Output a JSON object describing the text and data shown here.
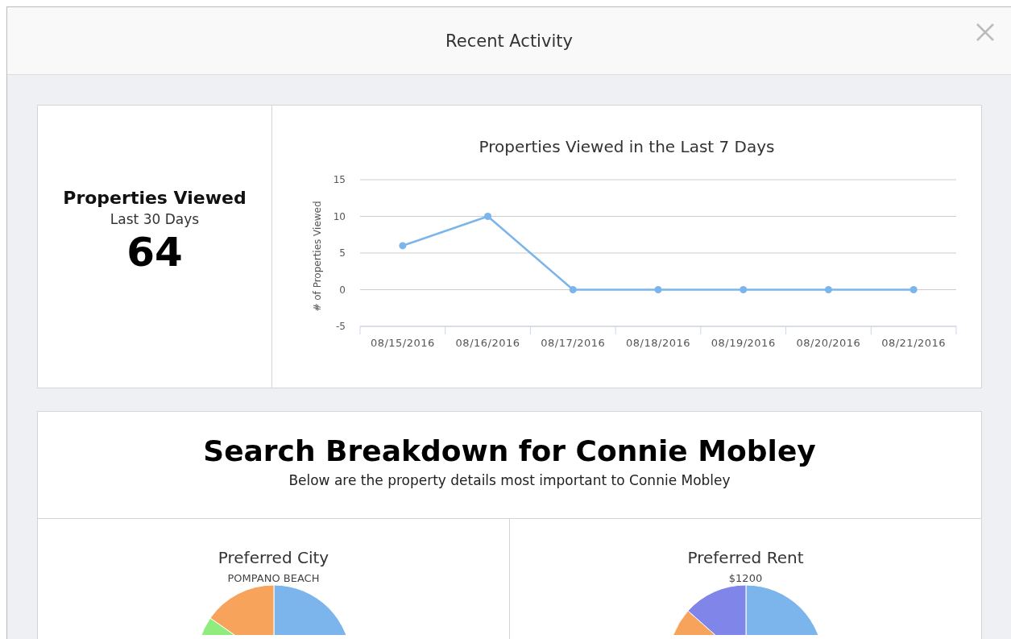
{
  "window": {
    "title": "Recent Activity"
  },
  "summary": {
    "title": "Properties Viewed",
    "subtitle": "Last 30 Days",
    "count": "64"
  },
  "activity_chart": {
    "chart_data": {
      "type": "line",
      "title": "Properties Viewed in the Last 7 Days",
      "ylabel": "# of Properties Viewed",
      "categories": [
        "08/15/2016",
        "08/16/2016",
        "08/17/2016",
        "08/18/2016",
        "08/19/2016",
        "08/20/2016",
        "08/21/2016"
      ],
      "series": [
        {
          "color": "#7cb5ec",
          "marker": true,
          "values": [
            6,
            10,
            0,
            0,
            0,
            0,
            0
          ]
        }
      ],
      "ylim": [
        -5,
        15
      ],
      "yticks": [
        -5,
        0,
        5,
        10,
        15
      ],
      "grid": true
    }
  },
  "breakdown": {
    "title": "Search Breakdown for Connie Mobley",
    "subtitle": "Below are the property details most important to Connie Mobley",
    "panels": [
      {
        "title": "Preferred City",
        "label": "POMPANO BEACH",
        "kind": "city"
      },
      {
        "title": "Preferred Rent",
        "label": "$1200",
        "kind": "rent"
      }
    ]
  }
}
